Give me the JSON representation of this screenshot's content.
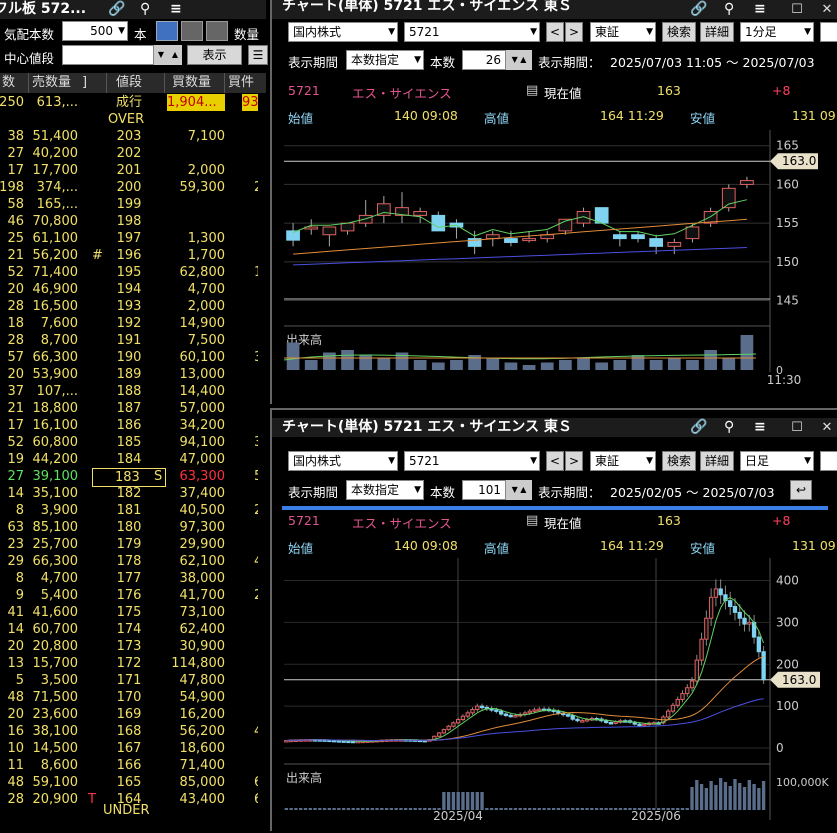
{
  "board": {
    "title": "フル板 572...",
    "qty_label": "気配本数",
    "qty_value": "500",
    "hon": "本",
    "suryo": "数量",
    "center_label": "中心値段",
    "display_btn": "表示",
    "headers": [
      "数",
      "売数量",
      "]",
      "値段",
      "買数量",
      "買件"
    ],
    "top_row": {
      "c1": "250",
      "c2": "613,...",
      "price": "成行",
      "c5": "1,904...",
      "c6": "93"
    },
    "over": "OVER",
    "under": "UNDER",
    "rows": [
      {
        "c1": "38",
        "c2": "51,400",
        "p": "203",
        "b": "7,100",
        "s": "",
        "h": ""
      },
      {
        "c1": "27",
        "c2": "40,200",
        "p": "202",
        "b": "",
        "s": "",
        "h": ""
      },
      {
        "c1": "17",
        "c2": "17,700",
        "p": "201",
        "b": "2,000",
        "s": "",
        "h": ""
      },
      {
        "c1": "198",
        "c2": "374,...",
        "p": "200",
        "b": "59,300",
        "s": "2",
        "h": ""
      },
      {
        "c1": "58",
        "c2": "165,...",
        "p": "199",
        "b": "",
        "s": "",
        "h": ""
      },
      {
        "c1": "46",
        "c2": "70,800",
        "p": "198",
        "b": "",
        "s": "",
        "h": ""
      },
      {
        "c1": "25",
        "c2": "61,100",
        "p": "197",
        "b": "1,300",
        "s": "",
        "h": ""
      },
      {
        "c1": "21",
        "c2": "56,200",
        "p": "196",
        "b": "1,700",
        "s": "",
        "h": "#"
      },
      {
        "c1": "52",
        "c2": "71,400",
        "p": "195",
        "b": "62,800",
        "s": "1",
        "h": ""
      },
      {
        "c1": "20",
        "c2": "46,900",
        "p": "194",
        "b": "4,700",
        "s": "",
        "h": ""
      },
      {
        "c1": "28",
        "c2": "16,500",
        "p": "193",
        "b": "2,000",
        "s": "",
        "h": ""
      },
      {
        "c1": "18",
        "c2": "7,600",
        "p": "192",
        "b": "14,900",
        "s": "",
        "h": ""
      },
      {
        "c1": "28",
        "c2": "8,700",
        "p": "191",
        "b": "7,500",
        "s": "",
        "h": ""
      },
      {
        "c1": "57",
        "c2": "66,300",
        "p": "190",
        "b": "60,100",
        "s": "3",
        "h": ""
      },
      {
        "c1": "20",
        "c2": "53,900",
        "p": "189",
        "b": "13,000",
        "s": "",
        "h": ""
      },
      {
        "c1": "37",
        "c2": "107,...",
        "p": "188",
        "b": "14,400",
        "s": "",
        "h": ""
      },
      {
        "c1": "21",
        "c2": "18,800",
        "p": "187",
        "b": "57,000",
        "s": "",
        "h": ""
      },
      {
        "c1": "17",
        "c2": "16,100",
        "p": "186",
        "b": "34,200",
        "s": "",
        "h": ""
      },
      {
        "c1": "52",
        "c2": "60,800",
        "p": "185",
        "b": "94,100",
        "s": "3",
        "h": ""
      },
      {
        "c1": "19",
        "c2": "44,200",
        "p": "184",
        "b": "47,000",
        "s": "",
        "h": ""
      },
      {
        "c1": "27",
        "c2": "39,100",
        "p": "183",
        "b": "63,300",
        "s": "5",
        "h": "S",
        "cur": true
      },
      {
        "c1": "14",
        "c2": "35,100",
        "p": "182",
        "b": "37,400",
        "s": "",
        "h": ""
      },
      {
        "c1": "8",
        "c2": "3,900",
        "p": "181",
        "b": "40,500",
        "s": "2",
        "h": ""
      },
      {
        "c1": "63",
        "c2": "85,100",
        "p": "180",
        "b": "97,300",
        "s": "",
        "h": ""
      },
      {
        "c1": "23",
        "c2": "25,700",
        "p": "179",
        "b": "29,900",
        "s": "",
        "h": ""
      },
      {
        "c1": "29",
        "c2": "66,300",
        "p": "178",
        "b": "62,100",
        "s": "4",
        "h": ""
      },
      {
        "c1": "8",
        "c2": "4,700",
        "p": "177",
        "b": "38,000",
        "s": "",
        "h": ""
      },
      {
        "c1": "9",
        "c2": "5,400",
        "p": "176",
        "b": "41,700",
        "s": "2",
        "h": ""
      },
      {
        "c1": "41",
        "c2": "41,600",
        "p": "175",
        "b": "73,100",
        "s": "",
        "h": ""
      },
      {
        "c1": "14",
        "c2": "60,700",
        "p": "174",
        "b": "62,400",
        "s": "",
        "h": ""
      },
      {
        "c1": "20",
        "c2": "20,800",
        "p": "173",
        "b": "30,900",
        "s": "",
        "h": ""
      },
      {
        "c1": "13",
        "c2": "15,700",
        "p": "172",
        "b": "114,800",
        "s": "",
        "h": ""
      },
      {
        "c1": "5",
        "c2": "3,500",
        "p": "171",
        "b": "47,800",
        "s": "",
        "h": ""
      },
      {
        "c1": "48",
        "c2": "71,500",
        "p": "170",
        "b": "54,900",
        "s": "",
        "h": ""
      },
      {
        "c1": "20",
        "c2": "23,600",
        "p": "169",
        "b": "16,200",
        "s": "",
        "h": ""
      },
      {
        "c1": "16",
        "c2": "38,100",
        "p": "168",
        "b": "56,200",
        "s": "4",
        "h": ""
      },
      {
        "c1": "10",
        "c2": "14,500",
        "p": "167",
        "b": "18,600",
        "s": "",
        "h": ""
      },
      {
        "c1": "11",
        "c2": "8,600",
        "p": "166",
        "b": "71,400",
        "s": "",
        "h": ""
      },
      {
        "c1": "48",
        "c2": "59,100",
        "p": "165",
        "b": "85,000",
        "s": "6",
        "h": ""
      },
      {
        "c1": "28",
        "c2": "20,900",
        "p": "164",
        "b": "43,400",
        "s": "6",
        "h": "T"
      }
    ]
  },
  "chart1": {
    "title": "チャート(単体) 5721 エス・サイエンス 東Ｓ",
    "market": "国内株式",
    "code": "5721",
    "exchange": "東証",
    "search": "検索",
    "detail": "詳細",
    "interval": "1分足",
    "period_label": "表示期間",
    "period_mode": "本数指定",
    "count_label": "本数",
    "count": "26",
    "range_label": "表示期間：",
    "range": "2025/07/03 11:05 ～ 2025/07/03",
    "name_code": "5721",
    "name": "エス・サイエンス",
    "current_label": "現在値",
    "current": "163",
    "change": "+8",
    "open_label": "始値",
    "open": "140 09:08",
    "high_label": "高値",
    "high": "164 11:29",
    "low_label": "安値",
    "low": "131 09",
    "price_tag": "163.0",
    "y_ticks": [
      "165",
      "160",
      "155",
      "150",
      "145"
    ],
    "volume_label": "出来高",
    "vol_zero": "0",
    "x_label": "11:30"
  },
  "chart2": {
    "title": "チャート(単体) 5721 エス・サイエンス 東Ｓ",
    "market": "国内株式",
    "code": "5721",
    "exchange": "東証",
    "search": "検索",
    "detail": "詳細",
    "interval": "日足",
    "period_label": "表示期間",
    "period_mode": "本数指定",
    "count_label": "本数",
    "count": "101",
    "range_label": "表示期間：",
    "range": "2025/02/05 ～ 2025/07/03",
    "name_code": "5721",
    "name": "エス・サイエンス",
    "current_label": "現在値",
    "current": "163",
    "change": "+8",
    "open_label": "始値",
    "open": "140 09:08",
    "high_label": "高値",
    "high": "164 11:29",
    "low_label": "安値",
    "low": "131 09",
    "price_tag": "163.0",
    "y_ticks": [
      "400",
      "300",
      "200",
      "100",
      "0"
    ],
    "volume_label": "出来高",
    "vol_tick": "100,000K",
    "x_labels": [
      "2025/04",
      "2025/06"
    ]
  },
  "colors": {
    "up": "#ffffff",
    "down": "#7fd3f0",
    "price_line": "#ffffff",
    "ma_green": "#5fd35f",
    "ma_orange": "#e08c3a",
    "ma_blue": "#4a50e0"
  },
  "chart_data": [
    {
      "type": "candlestick",
      "title": "チャート(単体) 5721 エス・サイエンス 東Ｓ",
      "interval": "1分足",
      "ylim": [
        143,
        166
      ],
      "candles": [
        {
          "o": 154,
          "h": 155,
          "l": 152,
          "c": 152.8
        },
        {
          "o": 154.5,
          "h": 155.5,
          "l": 153.5,
          "c": 154.5
        },
        {
          "o": 153.5,
          "h": 154.5,
          "l": 152,
          "c": 154.5
        },
        {
          "o": 154,
          "h": 155,
          "l": 153.5,
          "c": 155
        },
        {
          "o": 155,
          "h": 158,
          "l": 154.5,
          "c": 156
        },
        {
          "o": 156,
          "h": 158.5,
          "l": 155,
          "c": 157.5
        },
        {
          "o": 156,
          "h": 159,
          "l": 155,
          "c": 157
        },
        {
          "o": 156,
          "h": 157,
          "l": 155,
          "c": 156.5
        },
        {
          "o": 156,
          "h": 156.5,
          "l": 154,
          "c": 154
        },
        {
          "o": 155,
          "h": 155.5,
          "l": 153,
          "c": 154.5
        },
        {
          "o": 153,
          "h": 154,
          "l": 151,
          "c": 152
        },
        {
          "o": 153,
          "h": 154,
          "l": 152,
          "c": 153.5
        },
        {
          "o": 153,
          "h": 154,
          "l": 152,
          "c": 152.5
        },
        {
          "o": 153,
          "h": 154,
          "l": 152.5,
          "c": 153
        },
        {
          "o": 153,
          "h": 154,
          "l": 152.5,
          "c": 153.5
        },
        {
          "o": 154,
          "h": 155.5,
          "l": 153.5,
          "c": 155.5
        },
        {
          "o": 155,
          "h": 157,
          "l": 154.5,
          "c": 156.5
        },
        {
          "o": 157,
          "h": 157,
          "l": 155,
          "c": 155
        },
        {
          "o": 153.5,
          "h": 154,
          "l": 152,
          "c": 153
        },
        {
          "o": 153.5,
          "h": 154,
          "l": 152.5,
          "c": 153
        },
        {
          "o": 153,
          "h": 153.5,
          "l": 151,
          "c": 152
        },
        {
          "o": 152,
          "h": 153,
          "l": 151,
          "c": 152.5
        },
        {
          "o": 153,
          "h": 155,
          "l": 152.5,
          "c": 154.5
        },
        {
          "o": 155,
          "h": 157,
          "l": 154.5,
          "c": 156.5
        },
        {
          "o": 157,
          "h": 160,
          "l": 156.5,
          "c": 159.5
        },
        {
          "o": 160,
          "h": 161,
          "l": 159.5,
          "c": 160.5
        }
      ],
      "volume": [
        55,
        20,
        35,
        40,
        30,
        25,
        35,
        20,
        15,
        20,
        30,
        25,
        15,
        10,
        15,
        20,
        25,
        15,
        20,
        30,
        20,
        25,
        20,
        40,
        25,
        70
      ]
    },
    {
      "type": "candlestick",
      "title": "チャート(単体) 5721 エス・サイエンス 東Ｓ",
      "interval": "日足",
      "ylim": [
        0,
        430
      ]
    }
  ]
}
